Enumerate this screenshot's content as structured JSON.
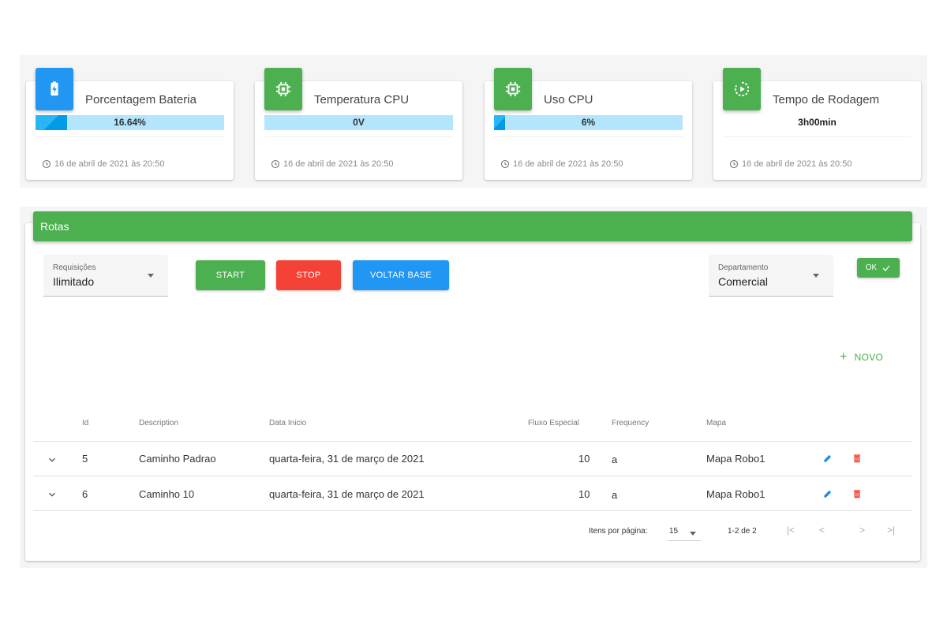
{
  "stats": [
    {
      "title": "Porcentagem Bateria",
      "value": "16.64%",
      "progress": 0.1664,
      "icon": "battery-charging-icon",
      "color": "#2196f3",
      "timestamp": "16 de abril de 2021 às 20:50"
    },
    {
      "title": "Temperatura CPU",
      "value": "0V",
      "progress": 0,
      "icon": "cpu-chip-icon",
      "color": "#4caf50",
      "timestamp": "16 de abril de 2021 às 20:50"
    },
    {
      "title": "Uso CPU",
      "value": "6%",
      "progress": 0.06,
      "icon": "cpu-chip-icon",
      "color": "#4caf50",
      "timestamp": "16 de abril de 2021 às 20:50"
    },
    {
      "title": "Tempo de Rodagem",
      "value": "3h00min",
      "icon": "play-circle-icon",
      "color": "#4caf50",
      "timestamp": "16 de abril de 2021 às 20:50"
    }
  ],
  "rotas": {
    "title": "Rotas",
    "requisicoes": {
      "label": "Requisições",
      "value": "Ilimitado"
    },
    "departamento": {
      "label": "Departamento",
      "value": "Comercial"
    },
    "buttons": {
      "start": "START",
      "stop": "STOP",
      "voltar": "VOLTAR BASE",
      "ok": "OK",
      "novo": "NOVO"
    },
    "colors": {
      "start": "#4caf50",
      "stop": "#f44336",
      "voltar": "#2196f3",
      "ok": "#4caf50"
    },
    "table": {
      "columns": [
        "Id",
        "Description",
        "Data Inicio",
        "Fluxo Especial",
        "Frequency",
        "Mapa"
      ],
      "rows": [
        {
          "id": "5",
          "description": "Caminho Padrao",
          "data": "quarta-feira, 31 de março de 2021",
          "fluxo": "10",
          "frequency": "a",
          "mapa": "Mapa Robo1"
        },
        {
          "id": "6",
          "description": "Caminho 10",
          "data": "quarta-feira, 31 de março de 2021",
          "fluxo": "10",
          "frequency": "a",
          "mapa": "Mapa Robo1"
        }
      ]
    },
    "pagination": {
      "items_label": "Itens por página:",
      "page_size": "15",
      "range": "1-2 de 2"
    }
  }
}
